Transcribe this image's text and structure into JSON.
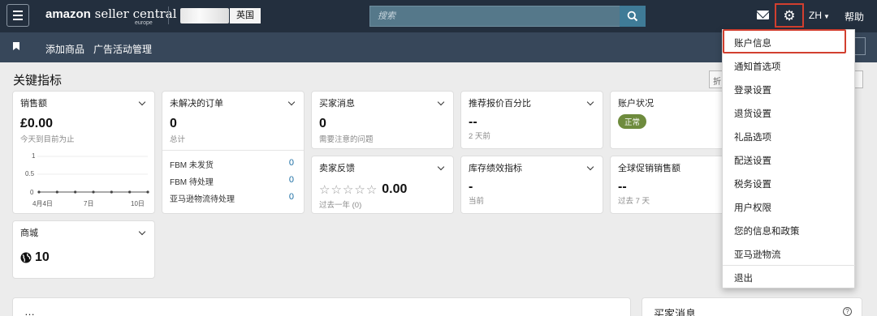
{
  "header": {
    "logo": "amazon",
    "logo_product": "seller central",
    "logo_region": "europe",
    "marketplace": "英国",
    "search_placeholder": "搜索",
    "language": "ZH",
    "help": "帮助"
  },
  "subnav": {
    "items": [
      "添加商品",
      "广告活动管理"
    ]
  },
  "main": {
    "title": "关键指标",
    "ghost_a": "折",
    "ghost_b": "折"
  },
  "cards": {
    "sales": {
      "title": "销售额",
      "value": "£0.00",
      "caption": "今天到目前为止",
      "chart": {
        "y_ticks": [
          "1",
          "0.5",
          "0"
        ],
        "x_ticks": [
          "4月4日",
          "7日",
          "10日"
        ]
      }
    },
    "orders": {
      "title": "未解决的订单",
      "value": "0",
      "caption": "总计",
      "rows": [
        {
          "label": "FBM 未发货",
          "value": "0"
        },
        {
          "label": "FBM 待处理",
          "value": "0"
        },
        {
          "label": "亚马逊物流待处理",
          "value": "0"
        }
      ]
    },
    "buyer_messages": {
      "title": "买家消息",
      "value": "0",
      "caption": "需要注意的问题"
    },
    "featured_offer": {
      "title": "推荐报价百分比",
      "value": "--",
      "caption": "2 天前"
    },
    "account_health": {
      "title": "账户状况",
      "badge": "正常"
    },
    "feedback": {
      "title": "卖家反馈",
      "rating": "0.00",
      "stars_filled": 0,
      "caption": "过去一年 (0)"
    },
    "inventory": {
      "title": "库存绩效指标",
      "value": "-",
      "caption": "当前"
    },
    "global_promo": {
      "title": "全球促销销售额",
      "value": "--",
      "caption": "过去 7 天"
    },
    "store": {
      "title": "商城",
      "value": "10"
    }
  },
  "settings_menu": {
    "items": [
      "账户信息",
      "通知首选项",
      "登录设置",
      "退货设置",
      "礼品选项",
      "配送设置",
      "税务设置",
      "用户权限",
      "您的信息和政策",
      "亚马逊物流"
    ],
    "logout": "退出",
    "highlighted": "账户信息"
  },
  "bottom": {
    "left_title": "…",
    "right_title": "买家消息"
  },
  "colors": {
    "topbar": "#232f3e",
    "subbar": "#37475a",
    "highlight": "#d23f2f",
    "status_green": "#6e8b3d",
    "link": "#1c6ea4"
  }
}
